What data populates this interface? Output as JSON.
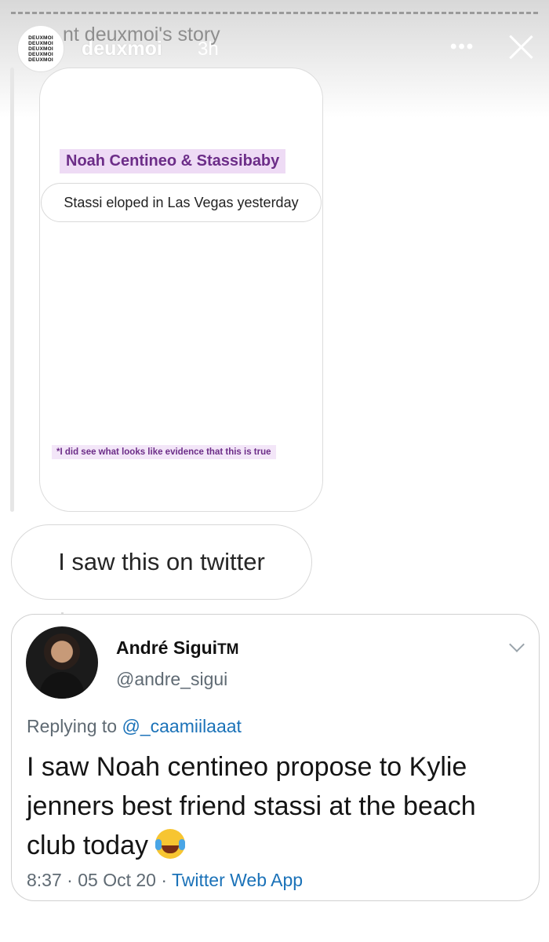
{
  "story": {
    "ghost_title": "nt deuxmoi's story",
    "username": "deuxmoi",
    "time_ago": "3h",
    "more_icon": "more-horizontal-icon",
    "close_icon": "close-icon",
    "logo_lines": [
      "DEUXMOI",
      "DEUXMOI",
      "DEUXMOI",
      "DEUXMOI",
      "DEUXMOI"
    ]
  },
  "story_card": {
    "headline": "Noah Centineo & Stassibaby",
    "question": "Stassi eloped in Las Vegas yesterday",
    "footnote": "*I did see what looks like evidence that this is true"
  },
  "message": {
    "text": "I saw this on twitter"
  },
  "tweet": {
    "display_name": "André Sigui",
    "tm": "TM",
    "handle": "@andre_sigui",
    "replying_prefix": "Replying to",
    "replying_to": "@_caamiilaaat",
    "body": "I saw Noah centineo propose to Kylie jenners best friend stassi at the beach club today",
    "emoji": "face-with-tears-of-joy",
    "time": "8:37",
    "date": "05 Oct 20",
    "source": "Twitter Web App",
    "separator": "·"
  },
  "colors": {
    "headline_bg": "#eedbf5",
    "headline_text": "#6c2d88",
    "link_blue": "#1b72b8",
    "muted": "#5f6a73"
  }
}
